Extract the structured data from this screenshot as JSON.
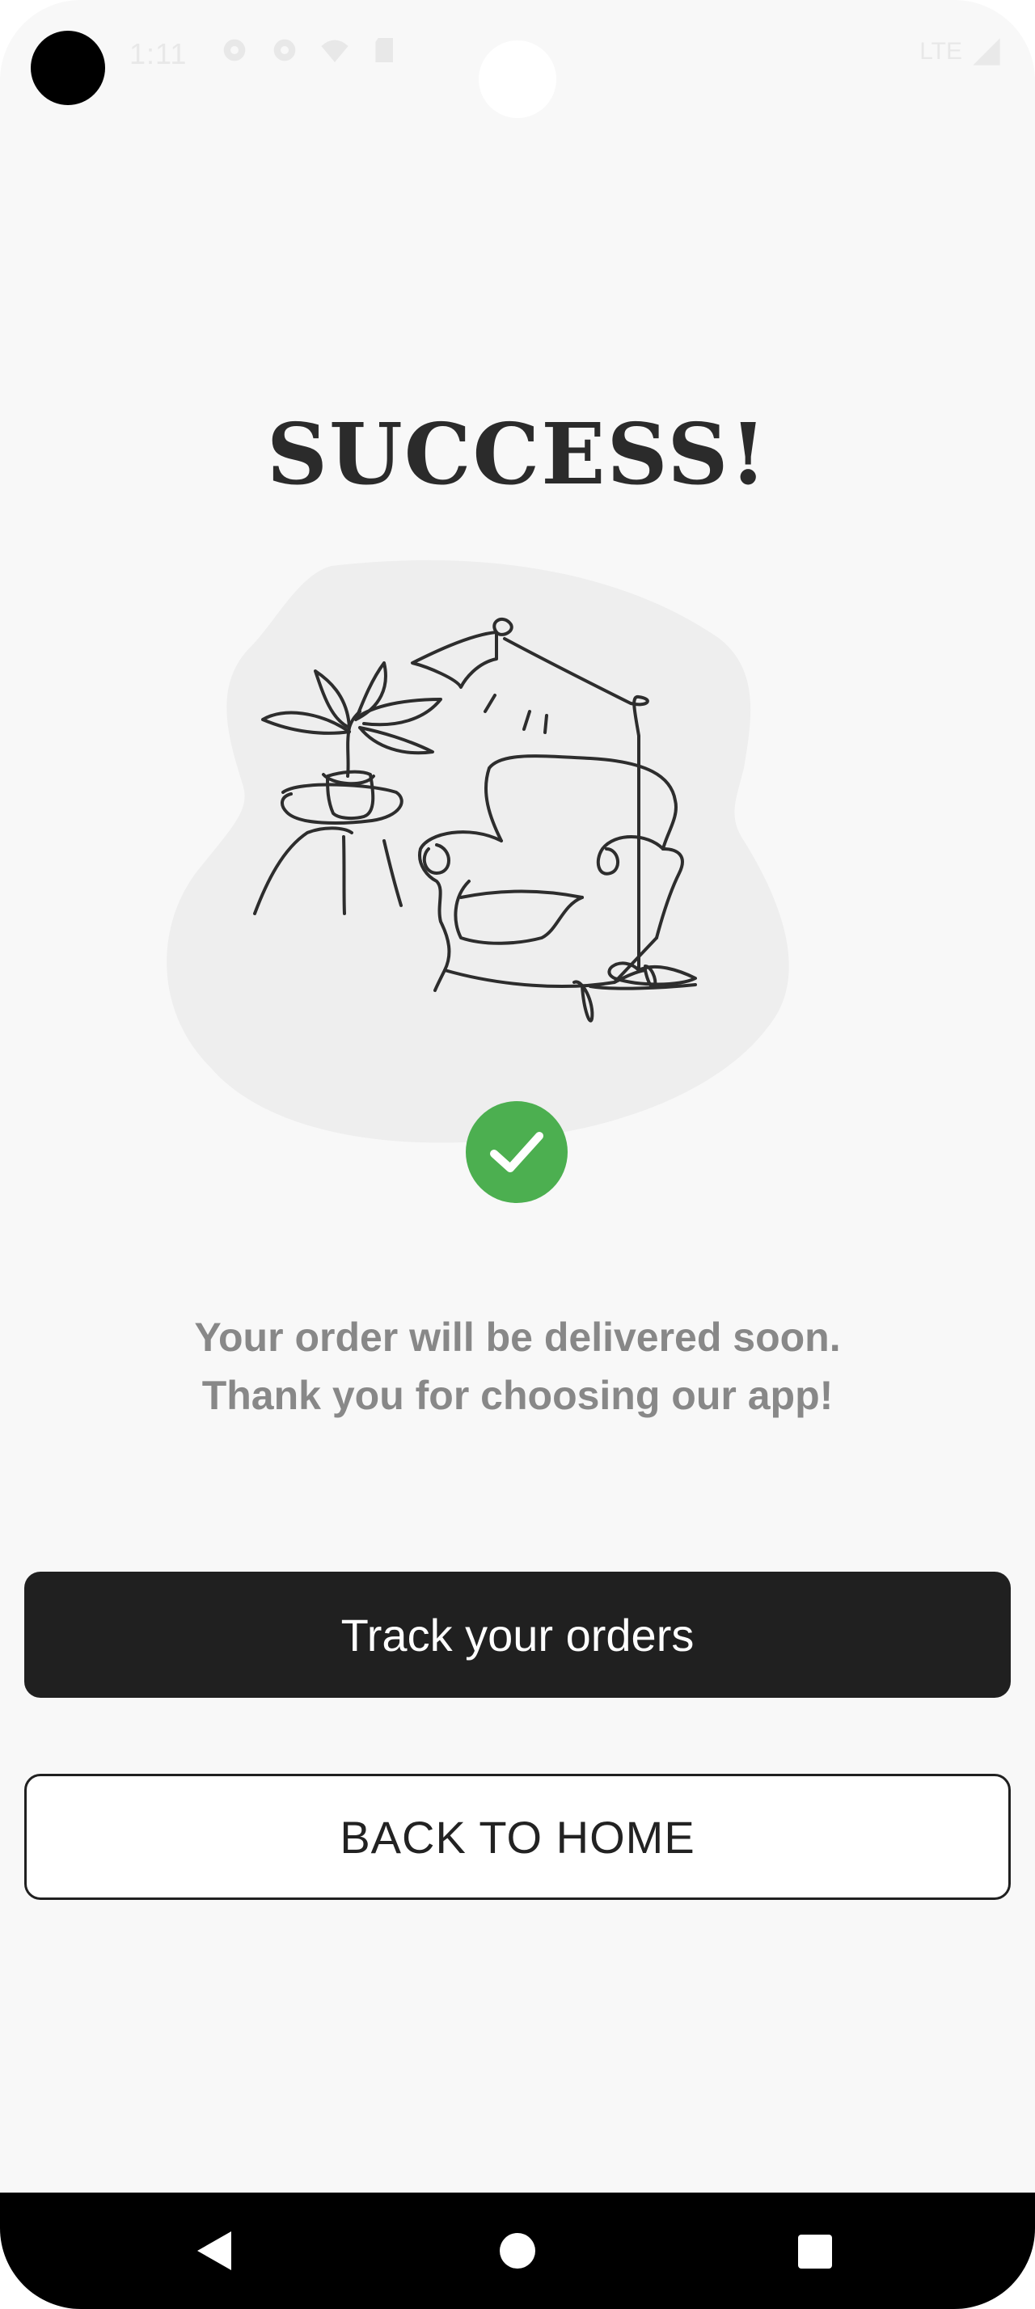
{
  "status_bar": {
    "time": "1:11",
    "network": "LTE",
    "icons": [
      "settings-icon",
      "settings-icon",
      "wifi-icon",
      "sd-card-icon",
      "signal-icon"
    ]
  },
  "screen": {
    "title": "SUCCESS!",
    "illustration": "armchair-plant-lamp-illustration",
    "check_icon": "check-icon",
    "message_line1": "Your order will be delivered soon.",
    "message_line2": "Thank you for choosing our app!"
  },
  "buttons": {
    "track_label": "Track your orders",
    "home_label": "BACK TO HOME"
  },
  "nav_bar": {
    "back": "back-icon",
    "home": "home-icon",
    "recents": "recents-icon"
  },
  "colors": {
    "accent_success": "#4caf50",
    "primary_button": "#202020",
    "background": "#f8f8f8",
    "message_text": "#888888"
  }
}
